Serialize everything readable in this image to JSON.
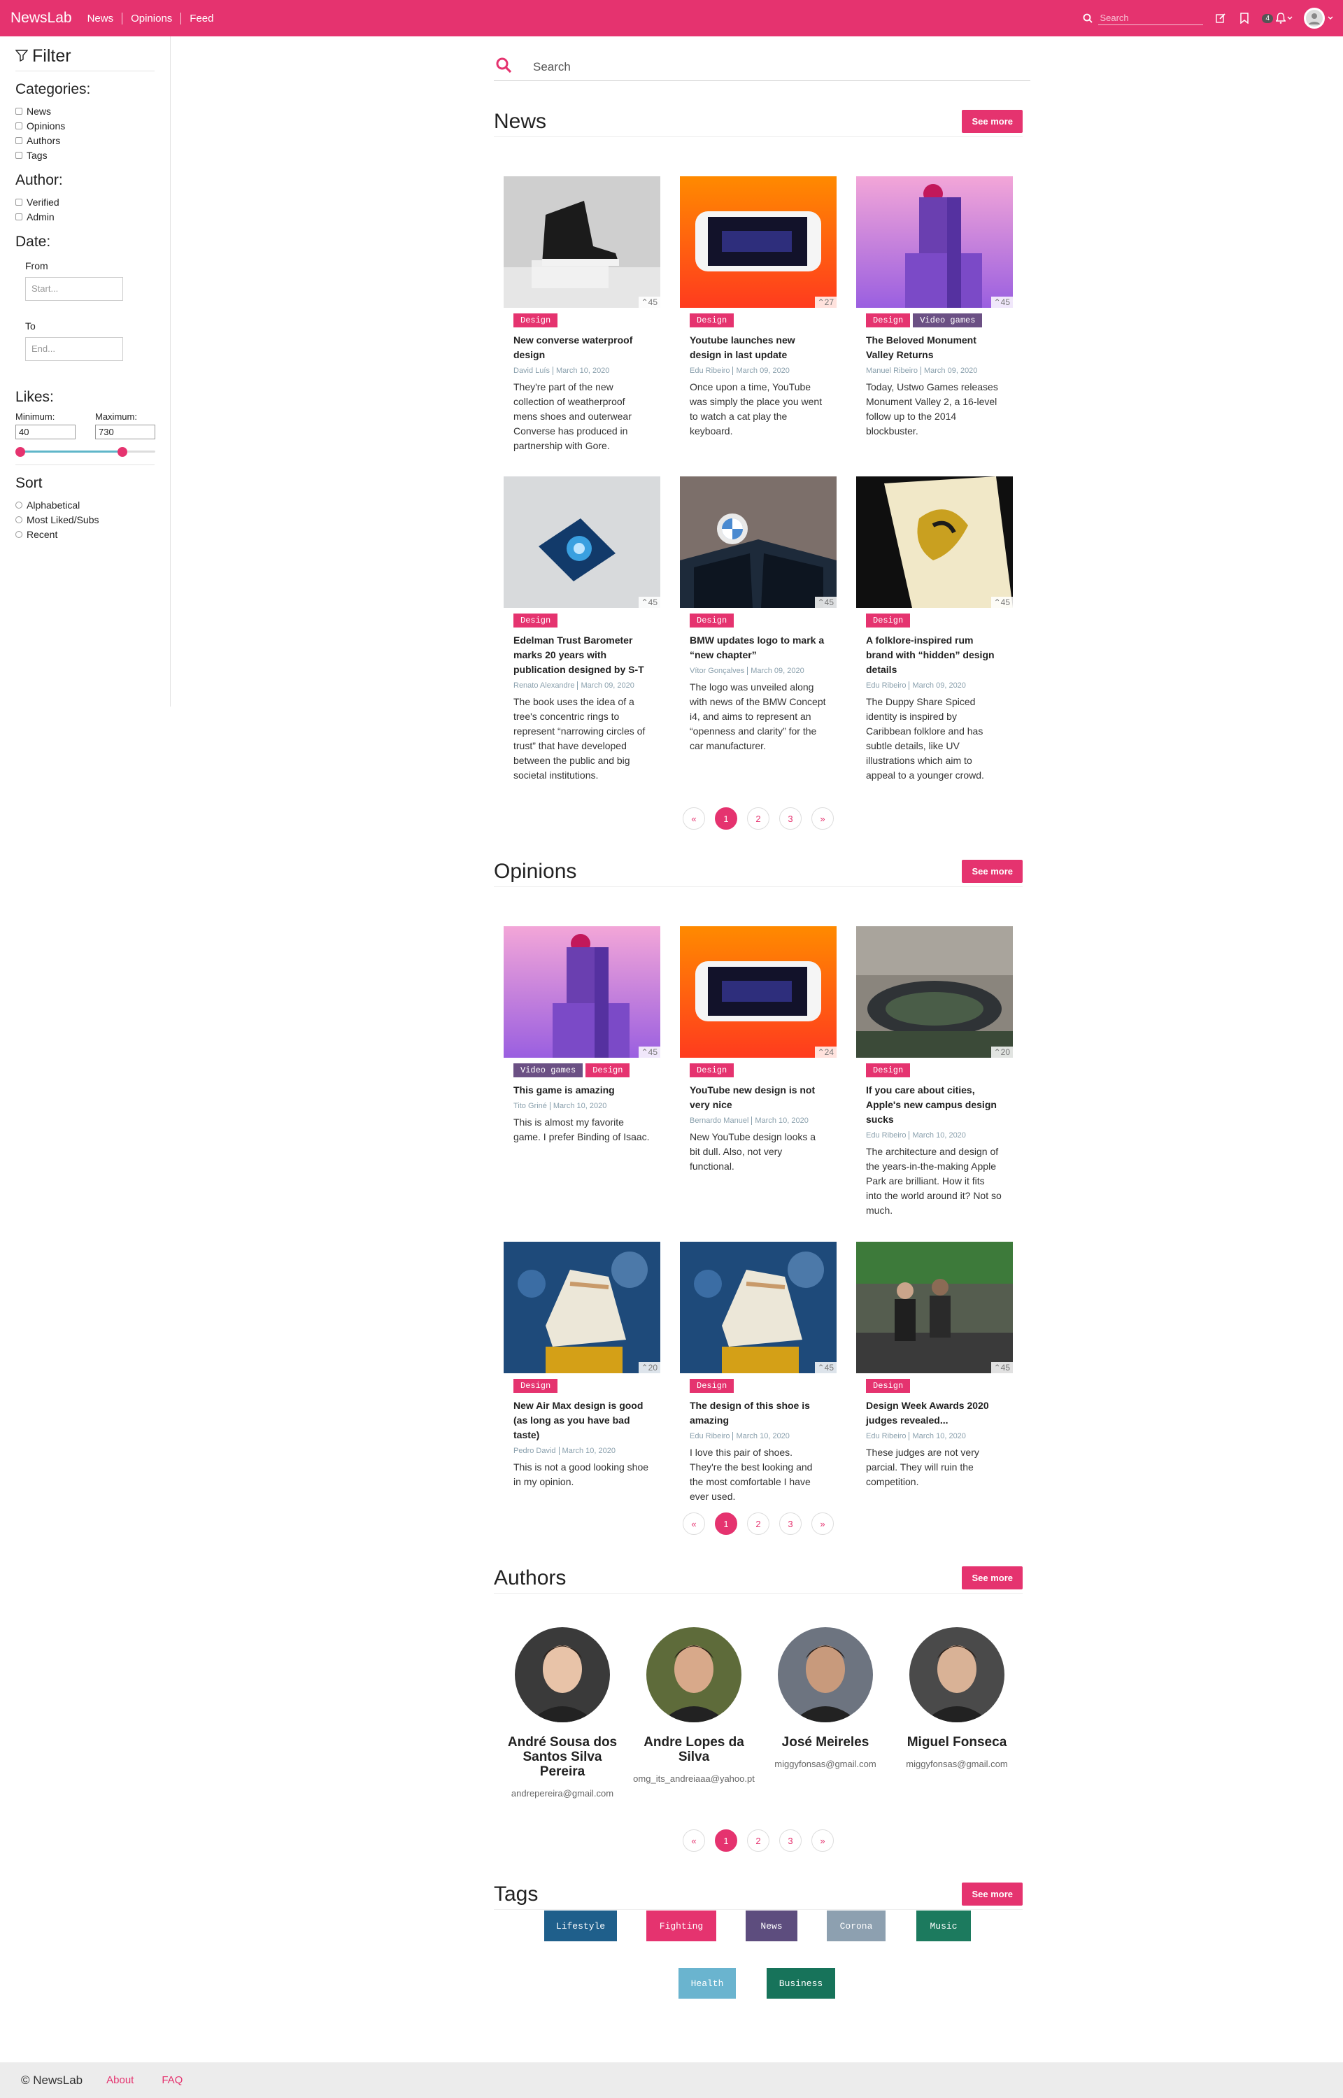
{
  "navbar": {
    "brand": "NewsLab",
    "links": [
      "News",
      "Opinions",
      "Feed"
    ],
    "search_placeholder": "Search",
    "notification_count": "4"
  },
  "sidebar": {
    "title": "Filter",
    "categories_title": "Categories:",
    "categories": [
      "News",
      "Opinions",
      "Authors",
      "Tags"
    ],
    "author_title": "Author:",
    "author_options": [
      "Verified",
      "Admin"
    ],
    "date_title": "Date:",
    "from_label": "From",
    "from_placeholder": "Start...",
    "to_label": "To",
    "to_placeholder": "End...",
    "likes_title": "Likes:",
    "min_label": "Minimum:",
    "min_value": "40",
    "max_label": "Maximum:",
    "max_value": "730",
    "slider_min_fraction": 0.0,
    "slider_max_fraction": 0.76,
    "sort_title": "Sort",
    "sort_options": [
      "Alphabetical",
      "Most Liked/Subs",
      "Recent"
    ]
  },
  "search": {
    "placeholder": "Search"
  },
  "see_more": "See more",
  "news": {
    "title": "News",
    "cards": [
      {
        "likes": "45",
        "tags": [
          "Design"
        ],
        "title": "New converse waterproof design",
        "author": "David Luís",
        "date": "March 10, 2020",
        "desc": "They're part of the new collection of weatherproof mens shoes and outerwear Converse has produced in partnership with Gore."
      },
      {
        "likes": "27",
        "tags": [
          "Design"
        ],
        "title": "Youtube launches new design in last update",
        "author": "Edu Ribeiro",
        "date": "March 09, 2020",
        "desc": "Once upon a time, YouTube was simply the place you went to watch a cat play the keyboard."
      },
      {
        "likes": "45",
        "tags": [
          "Design",
          "Video games"
        ],
        "title": "The Beloved Monument Valley Returns",
        "author": "Manuel Ribeiro",
        "date": "March 09, 2020",
        "desc": "Today, Ustwo Games releases Monument Valley 2, a 16-level follow up to the 2014 blockbuster."
      },
      {
        "likes": "45",
        "tags": [
          "Design"
        ],
        "title": "Edelman Trust Barometer marks 20 years with publication designed by S-T",
        "author": "Renato Alexandre",
        "date": "March 09, 2020",
        "desc": "The book uses the idea of a tree's concentric rings to represent “narrowing circles of trust” that have developed between the public and big societal institutions."
      },
      {
        "likes": "45",
        "tags": [
          "Design"
        ],
        "title": "BMW updates logo to mark a “new chapter”",
        "author": "Vítor Gonçalves",
        "date": "March 09, 2020",
        "desc": "The logo was unveiled along with news of the BMW Concept i4, and aims to represent an “openness and clarity” for the car manufacturer."
      },
      {
        "likes": "45",
        "tags": [
          "Design"
        ],
        "title": "A folklore-inspired rum brand with “hidden” design details",
        "author": "Edu Ribeiro",
        "date": "March 09, 2020",
        "desc": "The Duppy Share Spiced identity is inspired by Caribbean folklore and has subtle details, like UV illustrations which aim to appeal to a younger crowd."
      }
    ]
  },
  "opinions": {
    "title": "Opinions",
    "cards": [
      {
        "likes": "45",
        "tags": [
          "Video games",
          "Design"
        ],
        "title": "This game is amazing",
        "author": "Tito Griné",
        "date": "March 10, 2020",
        "desc": "This is almost my favorite game. I prefer Binding of Isaac."
      },
      {
        "likes": "24",
        "tags": [
          "Design"
        ],
        "title": "YouTube new design is not very nice",
        "author": "Bernardo Manuel",
        "date": "March 10, 2020",
        "desc": "New YouTube design looks a bit dull. Also, not very functional."
      },
      {
        "likes": "20",
        "tags": [
          "Design"
        ],
        "title": "If you care about cities, Apple's new campus design sucks",
        "author": "Edu Ribeiro",
        "date": "March 10, 2020",
        "desc": "The architecture and design of the years-in-the-making Apple Park are brilliant. How it fits into the world around it? Not so much."
      },
      {
        "likes": "20",
        "tags": [
          "Design"
        ],
        "title": "New Air Max design is good (as long as you have bad taste)",
        "author": "Pedro David",
        "date": "March 10, 2020",
        "desc": "This is not a good looking shoe in my opinion."
      },
      {
        "likes": "45",
        "tags": [
          "Design"
        ],
        "title": "The design of this shoe is amazing",
        "author": "Edu Ribeiro",
        "date": "March 10, 2020",
        "desc": "I love this pair of shoes. They're the best looking and the most comfortable I have ever used."
      },
      {
        "likes": "45",
        "tags": [
          "Design"
        ],
        "title": "Design Week Awards 2020 judges revealed...",
        "author": "Edu Ribeiro",
        "date": "March 10, 2020",
        "desc": "These judges are not very parcial. They will ruin the competition."
      }
    ]
  },
  "pager": {
    "prev": "«",
    "pages": [
      "1",
      "2",
      "3"
    ],
    "next": "»"
  },
  "authors": {
    "title": "Authors",
    "list": [
      {
        "name": "André Sousa dos Santos Silva Pereira",
        "email": "andrepereira@gmail.com"
      },
      {
        "name": "Andre Lopes da Silva",
        "email": "omg_its_andreiaaa@yahoo.pt"
      },
      {
        "name": "José Meireles",
        "email": "miggyfonsas@gmail.com"
      },
      {
        "name": "Miguel Fonseca",
        "email": "miggyfonsas@gmail.com"
      }
    ]
  },
  "tags": {
    "title": "Tags",
    "list": [
      {
        "label": "Lifestyle",
        "color": "#1f5f8b"
      },
      {
        "label": "Fighting",
        "color": "#e5336f"
      },
      {
        "label": "News",
        "color": "#5d4d7e"
      },
      {
        "label": "Corona",
        "color": "#8da0b0"
      },
      {
        "label": "Music",
        "color": "#1c7a5e"
      },
      {
        "label": "Health",
        "color": "#6ab4cf"
      },
      {
        "label": "Business",
        "color": "#17735a"
      }
    ]
  },
  "footer": {
    "copyright": "© NewsLab",
    "links": [
      "About",
      "FAQ"
    ]
  },
  "colors": {
    "accent": "#e5336f",
    "muted": "#8aa0ad"
  }
}
